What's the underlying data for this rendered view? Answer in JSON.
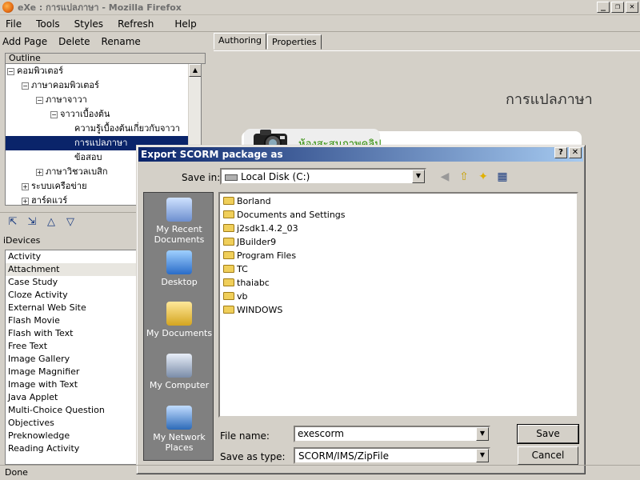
{
  "window": {
    "title": "eXe : การแปลภาษา - Mozilla Firefox"
  },
  "menubar": [
    "File",
    "Tools",
    "Styles",
    "Refresh",
    "Help"
  ],
  "toolbar": {
    "add_page": "Add Page",
    "delete": "Delete",
    "rename": "Rename"
  },
  "outline": {
    "header": "Outline",
    "items": [
      "คอมพิวเตอร์",
      "ภาษาคอมพิวเตอร์",
      "ภาษาจาวา",
      "จาวาเบื้องต้น",
      "ความรู้เบื้องต้นเกี่ยวกับจาวา",
      "การแปลภาษา",
      "ข้อสอบ",
      "ภาษาวิชวลเบสิก",
      "ระบบเครือข่าย",
      "ฮาร์ดแวร์"
    ],
    "selected": "การแปลภาษา"
  },
  "idevices": {
    "header": "iDevices",
    "items": [
      "Activity",
      "Attachment",
      "Case Study",
      "Cloze Activity",
      "External Web Site",
      "Flash Movie",
      "Flash with Text",
      "Free Text",
      "Image Gallery",
      "Image Magnifier",
      "Image with Text",
      "Java Applet",
      "Multi-Choice Question",
      "Objectives",
      "Preknowledge",
      "Reading Activity"
    ],
    "selected": "Attachment"
  },
  "tabs": {
    "authoring": "Authoring",
    "properties": "Properties"
  },
  "content": {
    "page_title": "การแปลภาษา",
    "idevice_title": "ห้องสะสมภาพคลิป"
  },
  "dialog": {
    "title": "Export SCORM package as",
    "save_in_label": "Save in:",
    "save_in_value": "Local Disk (C:)",
    "places": [
      "My Recent Documents",
      "Desktop",
      "My Documents",
      "My Computer",
      "My Network Places"
    ],
    "folders": [
      "Borland",
      "Documents and Settings",
      "j2sdk1.4.2_03",
      "JBuilder9",
      "Program Files",
      "TC",
      "thaiabc",
      "vb",
      "WINDOWS"
    ],
    "file_name_label": "File name:",
    "file_name_value": "exescorm",
    "save_as_type_label": "Save as type:",
    "save_as_type_value": "SCORM/IMS/ZipFile",
    "save_button": "Save",
    "cancel_button": "Cancel"
  },
  "status": {
    "text": "Done"
  },
  "colors": {
    "titlebar": "#0a246a",
    "selection": "#0a246a",
    "folder": "#f0cf5a",
    "idevice_title": "#2a8a00"
  }
}
